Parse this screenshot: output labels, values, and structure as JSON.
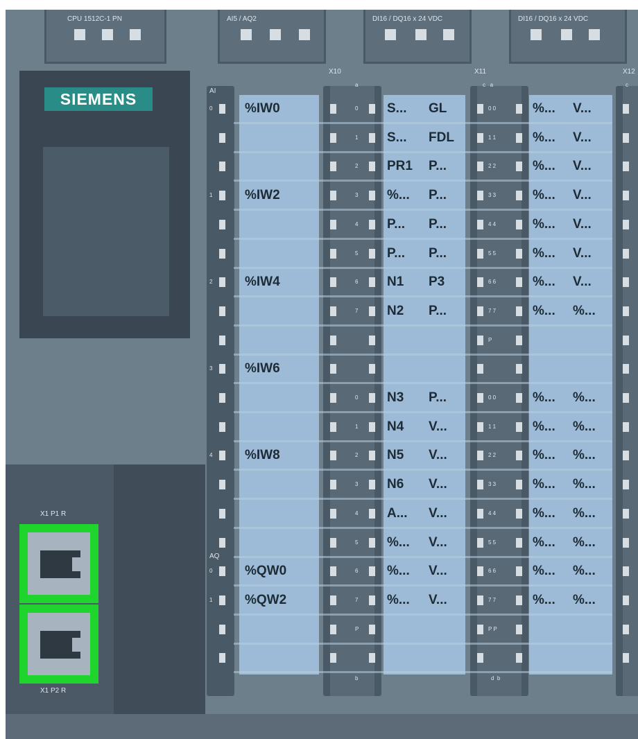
{
  "headers": {
    "cpu": "CPU 1512C-1 PN",
    "ai_aq": "AI5 / AQ2",
    "di_dq_1": "DI16 / DQ16 x 24 VDC",
    "di_dq_2": "DI16 / DQ16 x 24 VDC"
  },
  "connectors": {
    "x10": "X10",
    "x11": "X11",
    "x12": "X12"
  },
  "brand": "SIEMENS",
  "ports": {
    "p1": "X1 P1 R",
    "p2": "X1 P2 R"
  },
  "analog": {
    "ai_label": "AI",
    "aq_label": "AQ",
    "rows": [
      {
        "num": "0",
        "text": "%IW0"
      },
      {
        "num": "",
        "text": ""
      },
      {
        "num": "",
        "text": ""
      },
      {
        "num": "1",
        "text": "%IW2"
      },
      {
        "num": "",
        "text": ""
      },
      {
        "num": "",
        "text": ""
      },
      {
        "num": "2",
        "text": "%IW4"
      },
      {
        "num": "",
        "text": ""
      },
      {
        "num": "",
        "text": ""
      },
      {
        "num": "3",
        "text": "%IW6"
      },
      {
        "num": "",
        "text": ""
      },
      {
        "num": "",
        "text": ""
      },
      {
        "num": "4",
        "text": "%IW8"
      },
      {
        "num": "",
        "text": ""
      },
      {
        "num": "",
        "text": ""
      },
      {
        "num": "",
        "text": ""
      },
      {
        "num": "0",
        "text": "%QW0"
      },
      {
        "num": "1",
        "text": "%QW2"
      },
      {
        "num": "",
        "text": ""
      },
      {
        "num": "",
        "text": ""
      }
    ]
  },
  "x10": {
    "top_letter": "a",
    "bottom_letter": "b",
    "rows": [
      {
        "num": "0",
        "a": "S...",
        "b": "GL"
      },
      {
        "num": "1",
        "a": "S...",
        "b": "FDL"
      },
      {
        "num": "2",
        "a": "PR1",
        "b": "P..."
      },
      {
        "num": "3",
        "a": "%...",
        "b": "P..."
      },
      {
        "num": "4",
        "a": "P...",
        "b": "P..."
      },
      {
        "num": "5",
        "a": "P...",
        "b": "P..."
      },
      {
        "num": "6",
        "a": "N1",
        "b": "P3"
      },
      {
        "num": "7",
        "a": "N2",
        "b": "P..."
      },
      {
        "num": "",
        "a": "",
        "b": ""
      },
      {
        "num": "",
        "a": "",
        "b": ""
      },
      {
        "num": "0",
        "a": "N3",
        "b": "P..."
      },
      {
        "num": "1",
        "a": "N4",
        "b": "V..."
      },
      {
        "num": "2",
        "a": "N5",
        "b": "V..."
      },
      {
        "num": "3",
        "a": "N6",
        "b": "V..."
      },
      {
        "num": "4",
        "a": "A...",
        "b": "V..."
      },
      {
        "num": "5",
        "a": "%...",
        "b": "V..."
      },
      {
        "num": "6",
        "a": "%...",
        "b": "V..."
      },
      {
        "num": "7",
        "a": "%...",
        "b": "V..."
      },
      {
        "num": "P",
        "a": "",
        "b": ""
      },
      {
        "num": "",
        "a": "",
        "b": ""
      }
    ]
  },
  "x11": {
    "top_letters": "c   a",
    "bottom_letters": "d  b",
    "rows": [
      {
        "num": "0 0",
        "a": "%...",
        "b": "V..."
      },
      {
        "num": "1 1",
        "a": "%...",
        "b": "V..."
      },
      {
        "num": "2 2",
        "a": "%...",
        "b": "V..."
      },
      {
        "num": "3 3",
        "a": "%...",
        "b": "V..."
      },
      {
        "num": "4 4",
        "a": "%...",
        "b": "V..."
      },
      {
        "num": "5 5",
        "a": "%...",
        "b": "V..."
      },
      {
        "num": "6 6",
        "a": "%...",
        "b": "V..."
      },
      {
        "num": "7 7",
        "a": "%...",
        "b": "%..."
      },
      {
        "num": "P",
        "a": "",
        "b": ""
      },
      {
        "num": "",
        "a": "",
        "b": ""
      },
      {
        "num": "0 0",
        "a": "%...",
        "b": "%..."
      },
      {
        "num": "1 1",
        "a": "%...",
        "b": "%..."
      },
      {
        "num": "2 2",
        "a": "%...",
        "b": "%..."
      },
      {
        "num": "3 3",
        "a": "%...",
        "b": "%..."
      },
      {
        "num": "4 4",
        "a": "%...",
        "b": "%..."
      },
      {
        "num": "5 5",
        "a": "%...",
        "b": "%..."
      },
      {
        "num": "6 6",
        "a": "%...",
        "b": "%..."
      },
      {
        "num": "7 7",
        "a": "%...",
        "b": "%..."
      },
      {
        "num": "P P",
        "a": "",
        "b": ""
      },
      {
        "num": "",
        "a": "",
        "b": ""
      }
    ]
  },
  "x12": {
    "top_letter": "c"
  },
  "colors": {
    "panel": "#6e7f8c",
    "cell_blue": "#9dbbd6",
    "port_green": "#1fd42c",
    "brand_teal": "#2a8c87"
  }
}
